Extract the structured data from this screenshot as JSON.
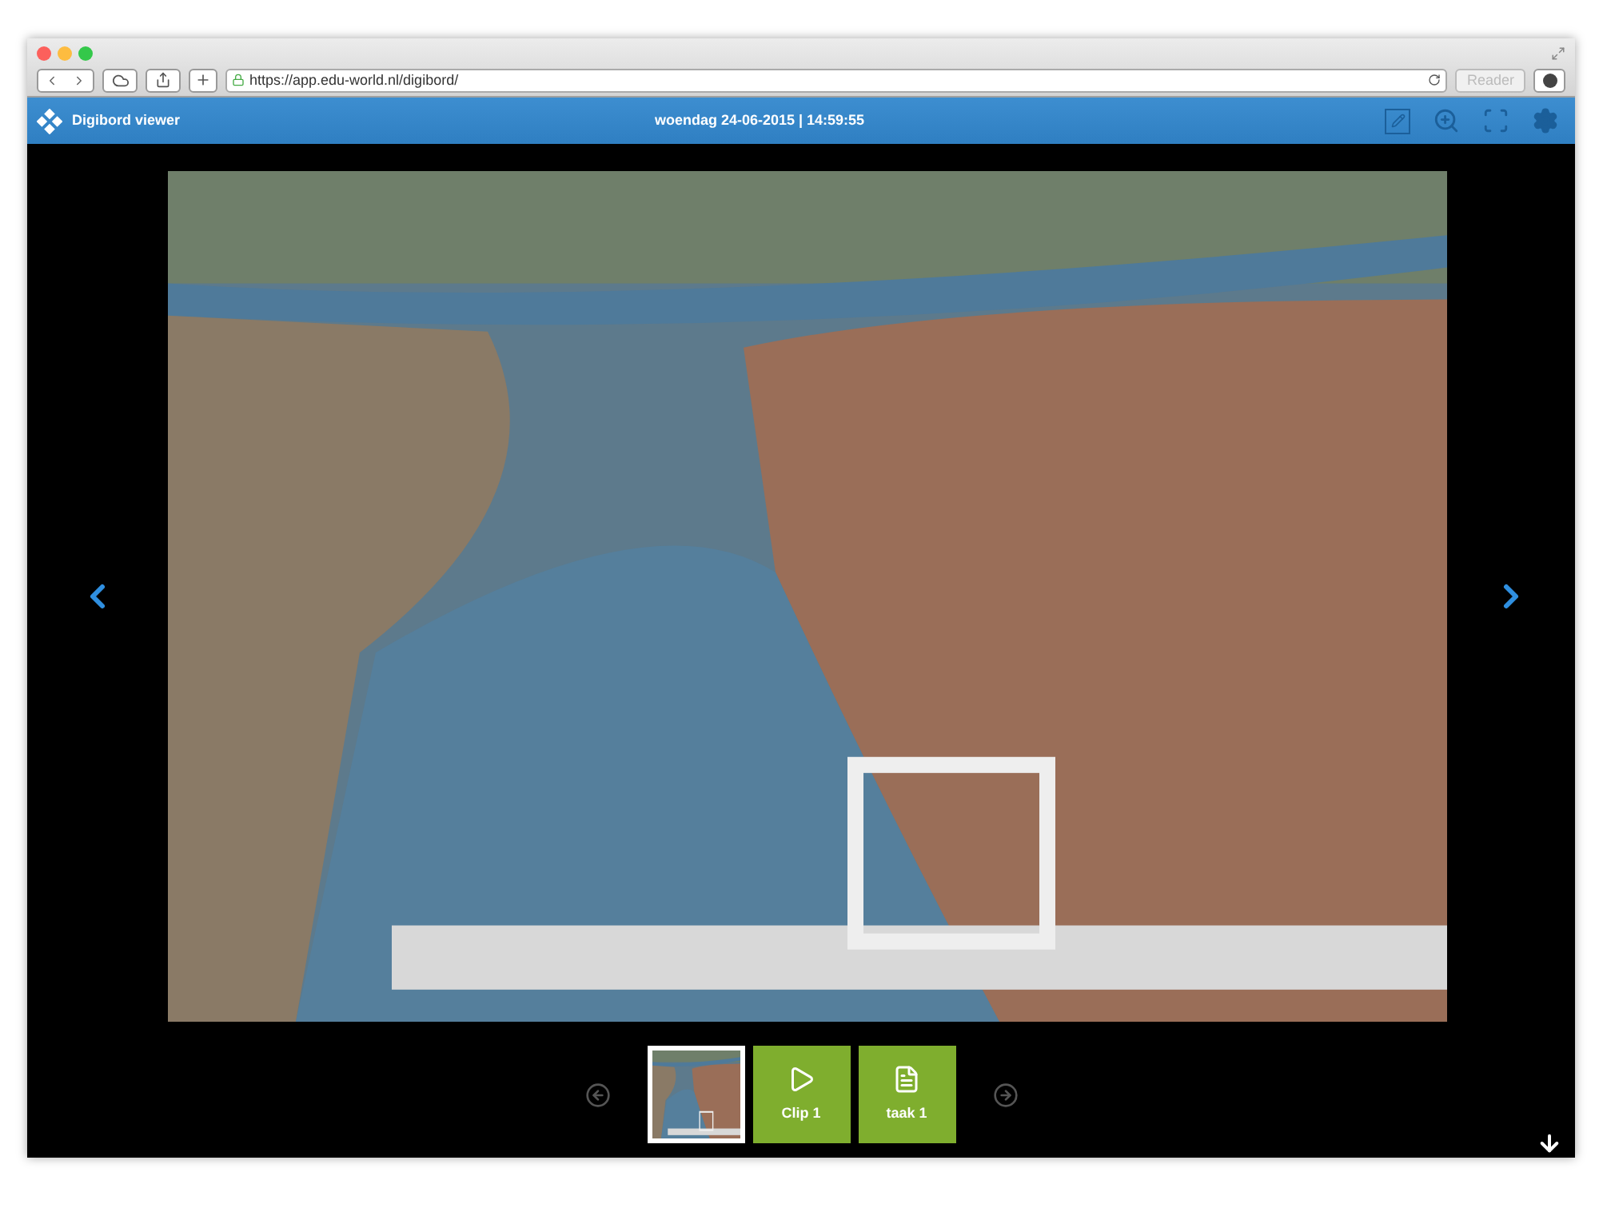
{
  "browser": {
    "url": "https://app.edu-world.nl/digibord/",
    "reader_button": "Reader"
  },
  "header": {
    "title": "Digibord viewer",
    "datetime": "woendag 24-06-2015 | 14:59:55"
  },
  "strip": [
    {
      "kind": "photo",
      "selected": true
    },
    {
      "kind": "video",
      "label": "Clip 1",
      "selected": false
    },
    {
      "kind": "document",
      "label": "taak 1",
      "selected": false
    }
  ]
}
